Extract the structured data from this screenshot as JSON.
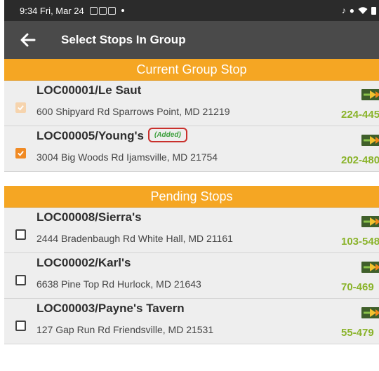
{
  "status_bar": {
    "time_date": "9:34  Fri, Mar 24",
    "icons": [
      "wifi-icon",
      "battery-icon"
    ]
  },
  "app_bar": {
    "title": "Select Stops In Group",
    "back_icon": "arrow-left-icon"
  },
  "current_section": {
    "title": "Current Group Stop",
    "items": [
      {
        "name": "LOC00001/Le Saut",
        "address": "600 Shipyard Rd Sparrows Point, MD 21219",
        "phone": "224-445",
        "checked": true,
        "disabled": true
      },
      {
        "name": "LOC00005/Young's",
        "address": "3004 Big Woods Rd Ijamsville, MD 21754",
        "phone": "202-480",
        "checked": true,
        "added_label": "(Added)"
      }
    ]
  },
  "pending_section": {
    "title": "Pending Stops",
    "items": [
      {
        "name": "LOC00008/Sierra's",
        "address": "2444 Bradenbaugh Rd White Hall, MD 21161",
        "phone": "103-548",
        "checked": false
      },
      {
        "name": "LOC00002/Karl's",
        "address": "6638 Pine Top Rd Hurlock, MD 21643",
        "phone": "70-469",
        "checked": false
      },
      {
        "name": "LOC00003/Payne's Tavern",
        "address": "127 Gap Run Rd Friendsville, MD 21531",
        "phone": "55-479",
        "checked": false
      }
    ]
  },
  "colors": {
    "accent_orange": "#f5a623",
    "phone_green": "#8ab32a",
    "added_border": "#c9302c",
    "app_bar": "#4a4a4a"
  }
}
